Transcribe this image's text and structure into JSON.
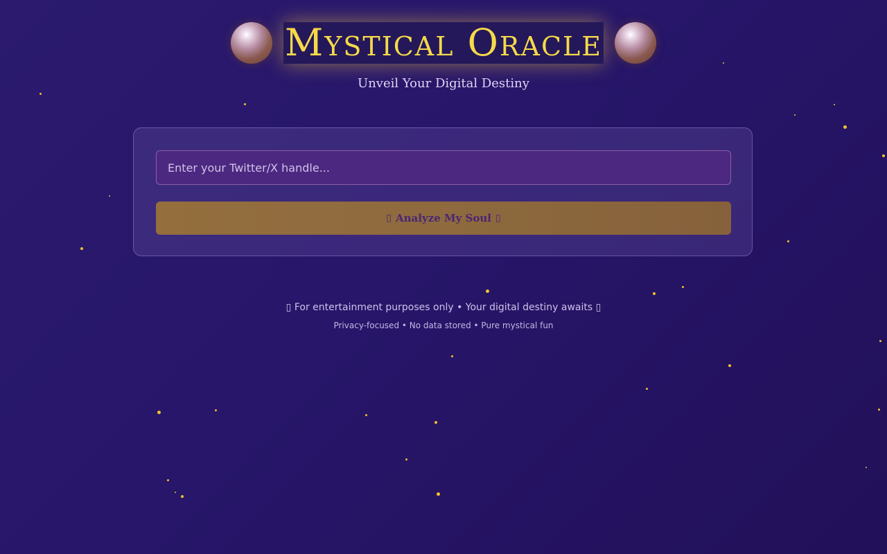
{
  "header": {
    "title": "Mystical Oracle",
    "subtitle": "Unveil Your Digital Destiny",
    "left_orb_icon": "crystal-ball-icon",
    "right_orb_icon": "crystal-ball-icon"
  },
  "form": {
    "handle_placeholder": "Enter your Twitter/X handle...",
    "handle_value": "",
    "analyze_label": "Analyze My Soul",
    "analyze_prefix_glyph": "▯",
    "analyze_suffix_glyph": "▯"
  },
  "footer": {
    "prefix_glyph": "▯",
    "disclaimer": "For entertainment purposes only • Your digital destiny awaits",
    "suffix_glyph": "▯",
    "privacy_note": "Privacy-focused • No data stored • Pure mystical fun"
  },
  "colors": {
    "background": "#27166a",
    "title": "#f5d94a",
    "star": "#f2c12e",
    "button": "#8e6a3e",
    "input": "#4c2880"
  }
}
